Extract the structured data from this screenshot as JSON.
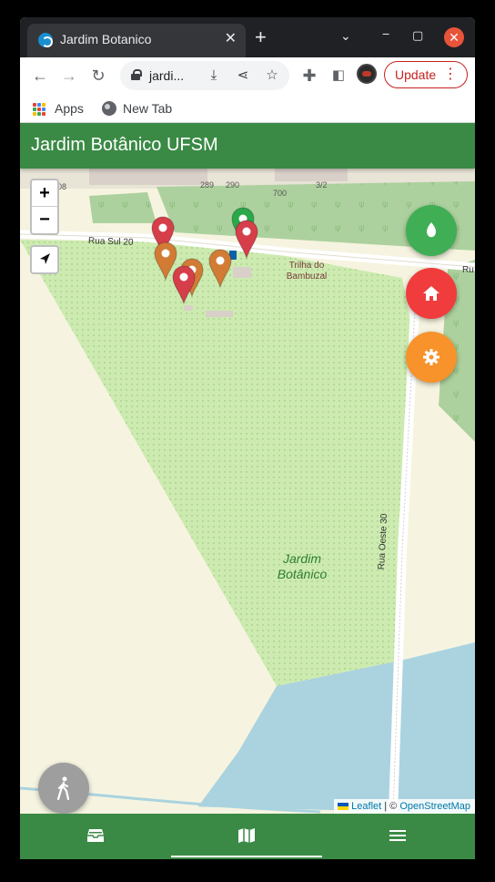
{
  "browser": {
    "tab_title": "Jardim Botanico",
    "tab_close": "✕",
    "new_tab": "+",
    "url": "jardi...",
    "update_label": "Update",
    "bookmarks": [
      "Apps",
      "New Tab"
    ]
  },
  "app": {
    "title": "Jardim Botânico UFSM"
  },
  "map": {
    "zoom_in": "+",
    "zoom_out": "−",
    "labels": {
      "road_north": "Rua Sul 20",
      "road_north_right": "Ru",
      "road_east": "Rua Oeste 30",
      "trail": "Trilha do Bambuzal",
      "park_line1": "Jardim",
      "park_line2": "Botânico",
      "house_numbers": [
        "289",
        "290",
        "700",
        "108",
        "3/2"
      ]
    },
    "attribution": {
      "leaflet": "Leaflet",
      "separator": " | © ",
      "osm": "OpenStreetMap"
    },
    "markers": [
      {
        "color": "#d63e4a",
        "kind": "red"
      },
      {
        "color": "#d27b35",
        "kind": "orange"
      },
      {
        "color": "#d27b35",
        "kind": "orange"
      },
      {
        "color": "#d63e4a",
        "kind": "red"
      },
      {
        "color": "#d27b35",
        "kind": "orange"
      },
      {
        "color": "#2aa84a",
        "kind": "green"
      },
      {
        "color": "#d63e4a",
        "kind": "red"
      }
    ]
  },
  "fabs": [
    {
      "name": "plant",
      "icon": "leaf-icon",
      "color": "#3fae55"
    },
    {
      "name": "home",
      "icon": "home-icon",
      "color": "#f03c3c"
    },
    {
      "name": "settings",
      "icon": "gear-icon",
      "color": "#f7932a"
    }
  ],
  "bottom_nav": [
    {
      "icon": "inbox-icon",
      "active": false
    },
    {
      "icon": "map-icon",
      "active": true
    },
    {
      "icon": "menu-icon",
      "active": false
    }
  ]
}
